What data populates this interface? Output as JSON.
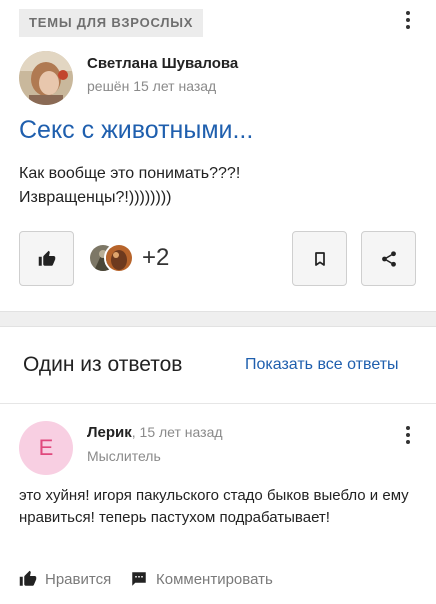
{
  "question": {
    "category": "Темы для взрослых",
    "author_name": "Светлана Шувалова",
    "time_text": "решён 15 лет назад",
    "title": "Секс с животными...",
    "body_line1": "Как вообще это понимать???!",
    "body_line2": "Извращенцы?!))))))))",
    "like_count": "+2"
  },
  "answers": {
    "heading": "Один из ответов",
    "show_all": "Показать все ответы"
  },
  "answer": {
    "avatar_letter": "Е",
    "author_name": "Лерик",
    "time_text": ", 15 лет назад",
    "rank": "Мыслитель",
    "body": "это хуйня! игоря пакульского стадо быков выебло и ему нравиться! теперь пастухом подрабатывает!",
    "like_label": "Нравится",
    "comment_label": "Комментировать"
  },
  "colors": {
    "link": "#1f5fae",
    "tag_bg": "#ececec",
    "answer_avatar_bg": "#f8cfe2",
    "answer_avatar_fg": "#e0497d"
  }
}
